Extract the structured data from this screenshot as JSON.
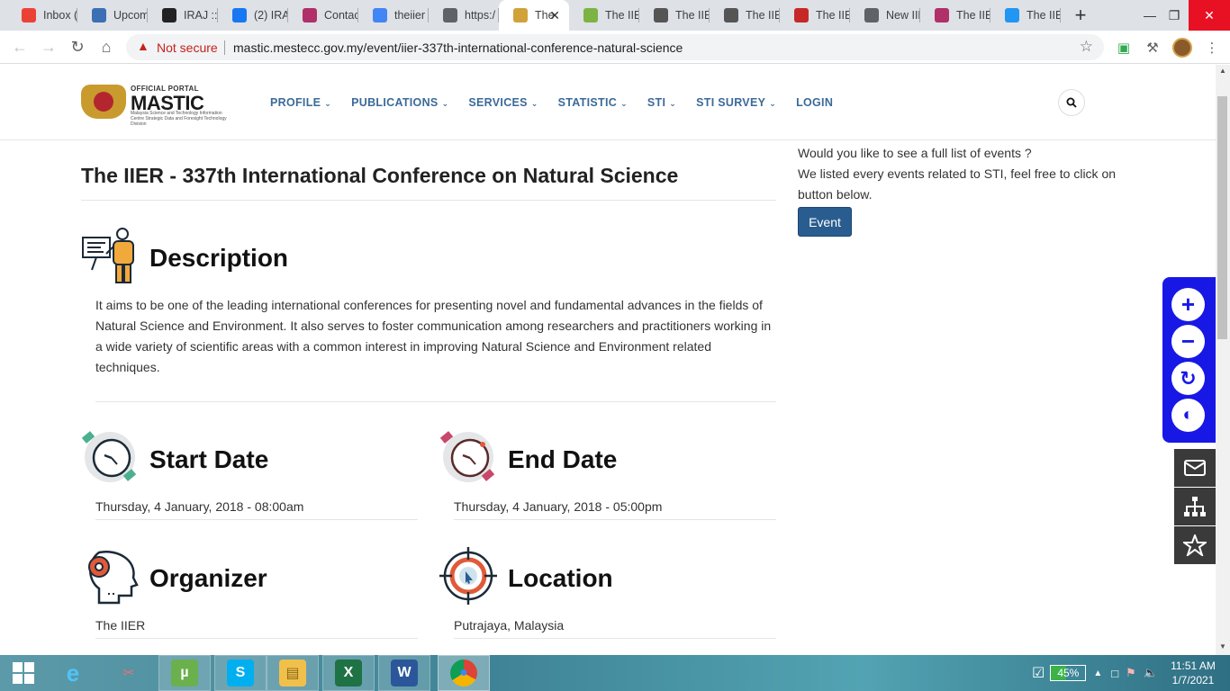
{
  "browser": {
    "tabs": [
      {
        "label": "Inbox (",
        "icon": "gmail-icon",
        "color": "#ea4335"
      },
      {
        "label": "Upcom",
        "icon": "shield-icon",
        "color": "#3c6fb4"
      },
      {
        "label": "IRAJ :: I",
        "icon": "iraj-icon",
        "color": "#222222"
      },
      {
        "label": "(2) IRA",
        "icon": "facebook-icon",
        "color": "#1877f2"
      },
      {
        "label": "Contac",
        "icon": "flower-icon",
        "color": "#b0306a"
      },
      {
        "label": "theiier",
        "icon": "google-icon",
        "color": "#4285f4"
      },
      {
        "label": "https:/",
        "icon": "globe-icon",
        "color": "#5f6368"
      },
      {
        "label": "The",
        "icon": "mastic-icon",
        "color": "#d1a23a",
        "active": true
      },
      {
        "label": "The IIER",
        "icon": "leaf-icon",
        "color": "#7cb342"
      },
      {
        "label": "The IIER",
        "icon": "iier-icon",
        "color": "#555555"
      },
      {
        "label": "The IIER",
        "icon": "conference-icon",
        "color": "#555555"
      },
      {
        "label": "The IIER",
        "icon": "k-icon",
        "color": "#c62828"
      },
      {
        "label": "New IIE",
        "icon": "globe-icon",
        "color": "#5f6368"
      },
      {
        "label": "The IIE",
        "icon": "ribbon-icon",
        "color": "#b0306a"
      },
      {
        "label": "The IIE",
        "icon": "swoosh-icon",
        "color": "#2196f3"
      }
    ],
    "security_label": "Not secure",
    "url": "mastic.mestecc.gov.my/event/iier-337th-international-conference-natural-science"
  },
  "header": {
    "logo_official": "OFFICIAL PORTAL",
    "logo_name": "MASTIC",
    "logo_sub": "Malaysia Science and Technology Information Centre Strategic Data and Foresight Technology Division",
    "nav": [
      {
        "label": "PROFILE",
        "dropdown": true
      },
      {
        "label": "PUBLICATIONS",
        "dropdown": true
      },
      {
        "label": "SERVICES",
        "dropdown": true
      },
      {
        "label": "STATISTIC",
        "dropdown": true
      },
      {
        "label": "STI",
        "dropdown": true
      },
      {
        "label": "STI SURVEY",
        "dropdown": true
      },
      {
        "label": "LOGIN",
        "dropdown": false
      }
    ]
  },
  "event": {
    "title": "The IIER - 337th International Conference on Natural Science",
    "description_heading": "Description",
    "description": "It aims to be one of the leading international conferences for presenting novel and fundamental advances in the fields of Natural Science and Environment. It also serves to foster communication among researchers and practitioners working in a wide variety of scientific areas with a common interest in improving Natural Science and Environment related techniques.",
    "start_heading": "Start Date",
    "start_value": "Thursday, 4 January, 2018 - 08:00am",
    "end_heading": "End Date",
    "end_value": "Thursday, 4 January, 2018 - 05:00pm",
    "organizer_heading": "Organizer",
    "organizer_value": "The IIER",
    "location_heading": "Location",
    "location_value": "Putrajaya, Malaysia"
  },
  "sidebar": {
    "line1": "Would you like to see a full list of events ?",
    "line2": "We listed every events related to STI, feel free to click on button below.",
    "button": "Event"
  },
  "accessibility": {
    "color": "#1818e6",
    "buttons": [
      "zoom-in-icon",
      "zoom-out-icon",
      "reset-icon",
      "contrast-icon"
    ]
  },
  "dock": [
    "feedback-icon",
    "sitemap-icon",
    "favorite-icon"
  ],
  "taskbar": {
    "items": [
      "ie-icon",
      "snipping-icon",
      "utorrent-icon",
      "skype-icon",
      "explorer-icon",
      "excel-icon",
      "word-icon",
      "chrome-icon"
    ],
    "battery": "45%",
    "time": "11:51 AM",
    "date": "1/7/2021"
  }
}
